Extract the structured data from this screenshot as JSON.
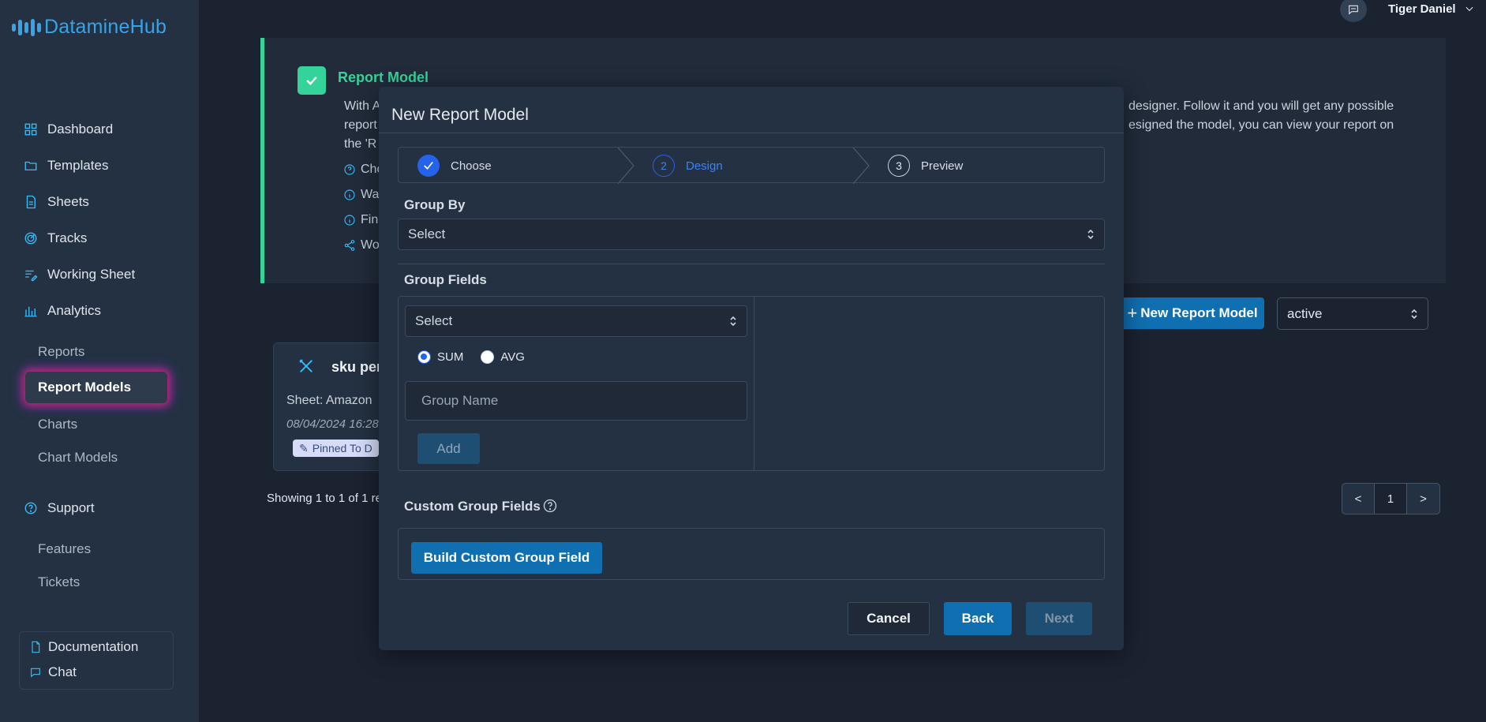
{
  "app": {
    "name": "DatamineHub"
  },
  "header": {
    "user_name": "Tiger Daniel"
  },
  "sidebar": {
    "main_items": [
      {
        "label": "Dashboard",
        "icon": "grid-icon"
      },
      {
        "label": "Templates",
        "icon": "folder-icon"
      },
      {
        "label": "Sheets",
        "icon": "document-icon"
      },
      {
        "label": "Tracks",
        "icon": "radar-icon"
      },
      {
        "label": "Working Sheet",
        "icon": "list-edit-icon"
      },
      {
        "label": "Analytics",
        "icon": "bar-chart-icon"
      }
    ],
    "analytics_items": [
      {
        "label": "Reports"
      },
      {
        "label": "Report Models",
        "active": true
      },
      {
        "label": "Charts"
      },
      {
        "label": "Chart Models"
      }
    ],
    "support": {
      "label": "Support",
      "icon": "help-circle-icon"
    },
    "support_items": [
      {
        "label": "Features"
      },
      {
        "label": "Tickets"
      }
    ],
    "documentation": {
      "label": "Documentation",
      "icon": "file-icon"
    },
    "chat": {
      "label": "Chat",
      "icon": "chat-icon"
    }
  },
  "info_panel": {
    "title": "Report Model",
    "line1_left": "With A",
    "line1_right": "designer. Follow it and you will get any possible",
    "line2_left": "report",
    "line2_right": "esigned the model, you can view your report on",
    "line3_left": "the 'R",
    "bullets": [
      {
        "text": "Cho",
        "icon": "help-circle-icon"
      },
      {
        "text": "Wa",
        "icon": "info-icon"
      },
      {
        "text": "Fin",
        "icon": "info-icon"
      },
      {
        "text": "Wo",
        "icon": "share-icon"
      }
    ]
  },
  "toolbar": {
    "new_report_model_label": "New Report Model",
    "status_select_value": "active"
  },
  "card": {
    "title": "sku per",
    "sheet": "Sheet: Amazon",
    "date": "08/04/2024 16:28",
    "badge": "Pinned To D"
  },
  "pagination": {
    "showing_text": "Showing 1 to 1 of 1 res",
    "prev_label": "<",
    "current_page": "1",
    "next_label": ">"
  },
  "modal": {
    "title": "New Report Model",
    "steps": [
      {
        "number": "",
        "label": "Choose",
        "state": "done"
      },
      {
        "number": "2",
        "label": "Design",
        "state": "current"
      },
      {
        "number": "3",
        "label": "Preview",
        "state": "pending"
      }
    ],
    "group_by": {
      "label": "Group By",
      "placeholder": "Select"
    },
    "group_fields": {
      "label": "Group Fields",
      "field_select": "Select",
      "radio_sum": "SUM",
      "radio_avg": "AVG",
      "selected_aggregation": "SUM",
      "group_name_placeholder": "Group Name",
      "add_label": "Add"
    },
    "custom_group_fields": {
      "label": "Custom Group Fields",
      "build_label": "Build Custom Group Field"
    },
    "footer": {
      "cancel_label": "Cancel",
      "back_label": "Back",
      "next_label": "Next"
    }
  },
  "colors": {
    "accent_blue": "#0f6fb0",
    "success_green": "#34d399",
    "sidebar_bg": "#243142",
    "page_bg": "#1b2331"
  }
}
